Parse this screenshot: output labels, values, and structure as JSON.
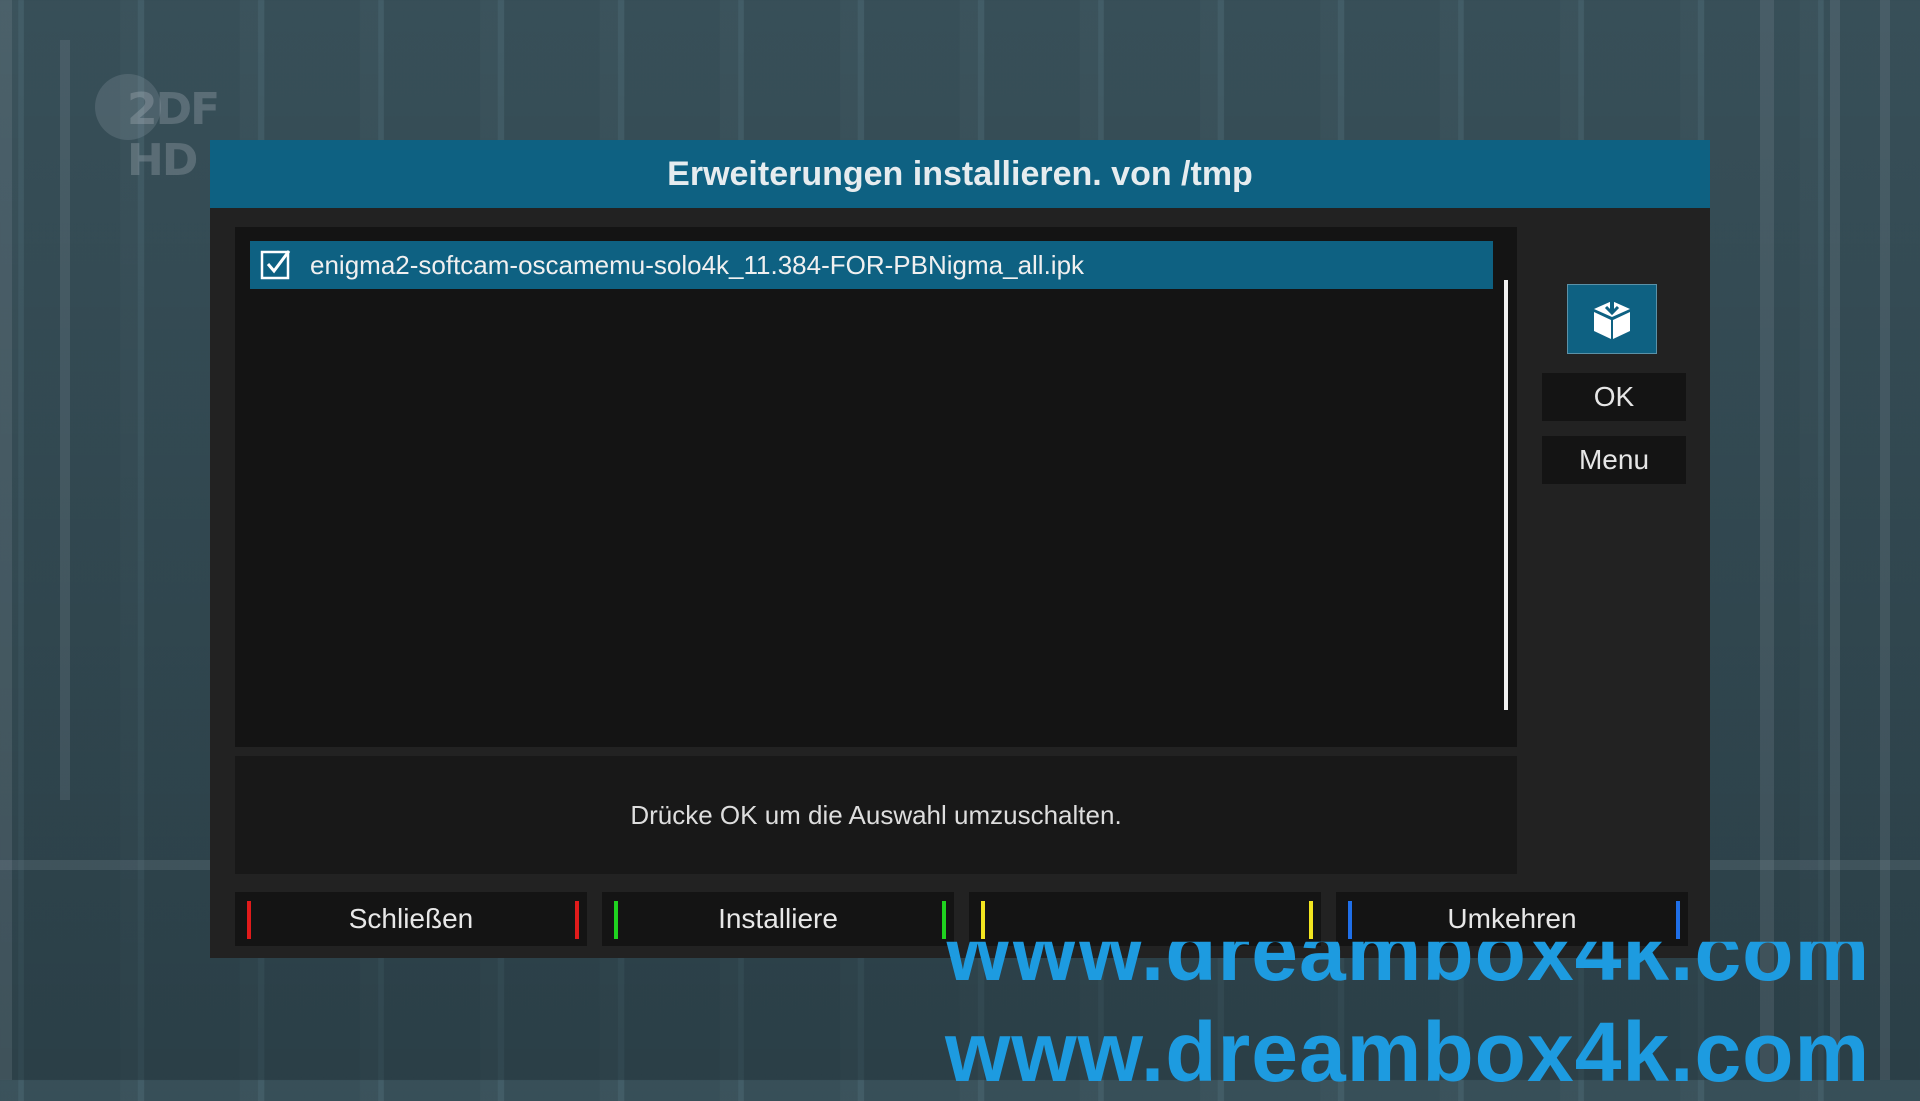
{
  "background": {
    "channel_logo": "2DF HD",
    "watermark_text": "www.dreambox4k.com"
  },
  "dialog": {
    "title": "Erweiterungen installieren. von /tmp",
    "colors": {
      "title_bar": "#0e6182",
      "selection": "#0e6182",
      "panel": "#222222"
    },
    "list": {
      "items": [
        {
          "label": "enigma2-softcam-oscamemu-solo4k_11.384-FOR-PBNigma_all.ipk",
          "checked": true,
          "selected": true
        }
      ]
    },
    "side": {
      "icon": "package-install-icon",
      "ok_label": "OK",
      "menu_label": "Menu"
    },
    "hint": "Drücke OK um die Auswahl umzuschalten.",
    "keys": [
      {
        "label": "Schließen",
        "color": "#e01b1b"
      },
      {
        "label": "Installiere",
        "color": "#1fd21f"
      },
      {
        "label": "",
        "color": "#f2e51f"
      },
      {
        "label": "Umkehren",
        "color": "#1f6fe8"
      }
    ]
  }
}
